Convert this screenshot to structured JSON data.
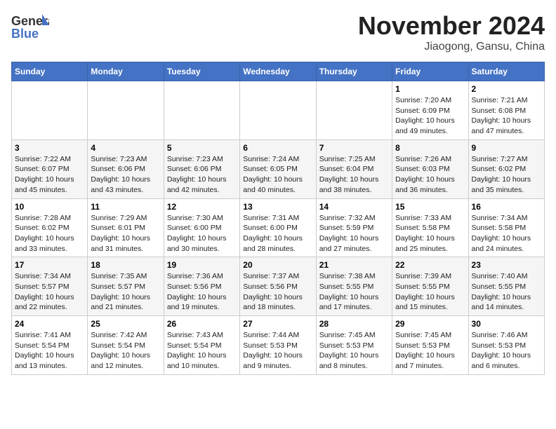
{
  "header": {
    "logo_general": "General",
    "logo_blue": "Blue",
    "title": "November 2024",
    "location": "Jiaogong, Gansu, China"
  },
  "calendar": {
    "days_of_week": [
      "Sunday",
      "Monday",
      "Tuesday",
      "Wednesday",
      "Thursday",
      "Friday",
      "Saturday"
    ],
    "weeks": [
      [
        {
          "day": "",
          "info": ""
        },
        {
          "day": "",
          "info": ""
        },
        {
          "day": "",
          "info": ""
        },
        {
          "day": "",
          "info": ""
        },
        {
          "day": "",
          "info": ""
        },
        {
          "day": "1",
          "info": "Sunrise: 7:20 AM\nSunset: 6:09 PM\nDaylight: 10 hours\nand 49 minutes."
        },
        {
          "day": "2",
          "info": "Sunrise: 7:21 AM\nSunset: 6:08 PM\nDaylight: 10 hours\nand 47 minutes."
        }
      ],
      [
        {
          "day": "3",
          "info": "Sunrise: 7:22 AM\nSunset: 6:07 PM\nDaylight: 10 hours\nand 45 minutes."
        },
        {
          "day": "4",
          "info": "Sunrise: 7:23 AM\nSunset: 6:06 PM\nDaylight: 10 hours\nand 43 minutes."
        },
        {
          "day": "5",
          "info": "Sunrise: 7:23 AM\nSunset: 6:06 PM\nDaylight: 10 hours\nand 42 minutes."
        },
        {
          "day": "6",
          "info": "Sunrise: 7:24 AM\nSunset: 6:05 PM\nDaylight: 10 hours\nand 40 minutes."
        },
        {
          "day": "7",
          "info": "Sunrise: 7:25 AM\nSunset: 6:04 PM\nDaylight: 10 hours\nand 38 minutes."
        },
        {
          "day": "8",
          "info": "Sunrise: 7:26 AM\nSunset: 6:03 PM\nDaylight: 10 hours\nand 36 minutes."
        },
        {
          "day": "9",
          "info": "Sunrise: 7:27 AM\nSunset: 6:02 PM\nDaylight: 10 hours\nand 35 minutes."
        }
      ],
      [
        {
          "day": "10",
          "info": "Sunrise: 7:28 AM\nSunset: 6:02 PM\nDaylight: 10 hours\nand 33 minutes."
        },
        {
          "day": "11",
          "info": "Sunrise: 7:29 AM\nSunset: 6:01 PM\nDaylight: 10 hours\nand 31 minutes."
        },
        {
          "day": "12",
          "info": "Sunrise: 7:30 AM\nSunset: 6:00 PM\nDaylight: 10 hours\nand 30 minutes."
        },
        {
          "day": "13",
          "info": "Sunrise: 7:31 AM\nSunset: 6:00 PM\nDaylight: 10 hours\nand 28 minutes."
        },
        {
          "day": "14",
          "info": "Sunrise: 7:32 AM\nSunset: 5:59 PM\nDaylight: 10 hours\nand 27 minutes."
        },
        {
          "day": "15",
          "info": "Sunrise: 7:33 AM\nSunset: 5:58 PM\nDaylight: 10 hours\nand 25 minutes."
        },
        {
          "day": "16",
          "info": "Sunrise: 7:34 AM\nSunset: 5:58 PM\nDaylight: 10 hours\nand 24 minutes."
        }
      ],
      [
        {
          "day": "17",
          "info": "Sunrise: 7:34 AM\nSunset: 5:57 PM\nDaylight: 10 hours\nand 22 minutes."
        },
        {
          "day": "18",
          "info": "Sunrise: 7:35 AM\nSunset: 5:57 PM\nDaylight: 10 hours\nand 21 minutes."
        },
        {
          "day": "19",
          "info": "Sunrise: 7:36 AM\nSunset: 5:56 PM\nDaylight: 10 hours\nand 19 minutes."
        },
        {
          "day": "20",
          "info": "Sunrise: 7:37 AM\nSunset: 5:56 PM\nDaylight: 10 hours\nand 18 minutes."
        },
        {
          "day": "21",
          "info": "Sunrise: 7:38 AM\nSunset: 5:55 PM\nDaylight: 10 hours\nand 17 minutes."
        },
        {
          "day": "22",
          "info": "Sunrise: 7:39 AM\nSunset: 5:55 PM\nDaylight: 10 hours\nand 15 minutes."
        },
        {
          "day": "23",
          "info": "Sunrise: 7:40 AM\nSunset: 5:55 PM\nDaylight: 10 hours\nand 14 minutes."
        }
      ],
      [
        {
          "day": "24",
          "info": "Sunrise: 7:41 AM\nSunset: 5:54 PM\nDaylight: 10 hours\nand 13 minutes."
        },
        {
          "day": "25",
          "info": "Sunrise: 7:42 AM\nSunset: 5:54 PM\nDaylight: 10 hours\nand 12 minutes."
        },
        {
          "day": "26",
          "info": "Sunrise: 7:43 AM\nSunset: 5:54 PM\nDaylight: 10 hours\nand 10 minutes."
        },
        {
          "day": "27",
          "info": "Sunrise: 7:44 AM\nSunset: 5:53 PM\nDaylight: 10 hours\nand 9 minutes."
        },
        {
          "day": "28",
          "info": "Sunrise: 7:45 AM\nSunset: 5:53 PM\nDaylight: 10 hours\nand 8 minutes."
        },
        {
          "day": "29",
          "info": "Sunrise: 7:45 AM\nSunset: 5:53 PM\nDaylight: 10 hours\nand 7 minutes."
        },
        {
          "day": "30",
          "info": "Sunrise: 7:46 AM\nSunset: 5:53 PM\nDaylight: 10 hours\nand 6 minutes."
        }
      ]
    ]
  }
}
